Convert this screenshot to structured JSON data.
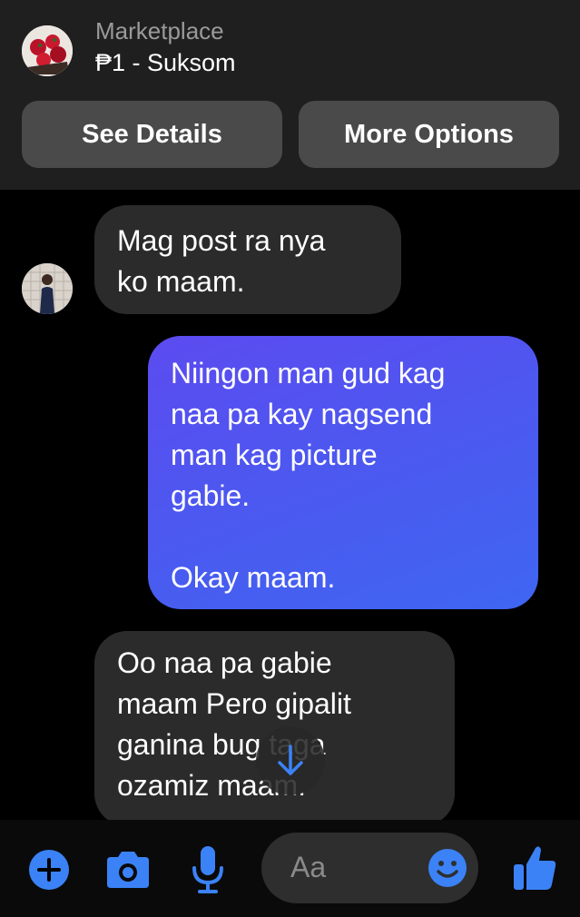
{
  "header": {
    "listing_label": "Marketplace",
    "listing_title": "₱1 - Suksom",
    "see_details": "See Details",
    "more_options": "More Options"
  },
  "messages": [
    {
      "from": "them",
      "text": "Mag post ra nya\nko maam."
    },
    {
      "from": "me",
      "text": "Niingon man gud kag\nnaa pa kay nagsend\nman kag picture\ngabie.\n\nOkay maam."
    },
    {
      "from": "them",
      "text": "Oo naa pa gabie\nmaam Pero gipalit\nganina bug taga\nozamiz maam."
    }
  ],
  "composer": {
    "placeholder": "Aa",
    "icons": [
      "plus-icon",
      "camera-icon",
      "microphone-icon",
      "emoji-icon",
      "thumbs-up-icon"
    ]
  },
  "colors": {
    "accent": "#3b82f6",
    "outgoing_bubble_start": "#5c4bf0",
    "outgoing_bubble_end": "#3f66f2",
    "incoming_bubble": "#2b2b2b",
    "header_bg": "#1f1f1f"
  }
}
